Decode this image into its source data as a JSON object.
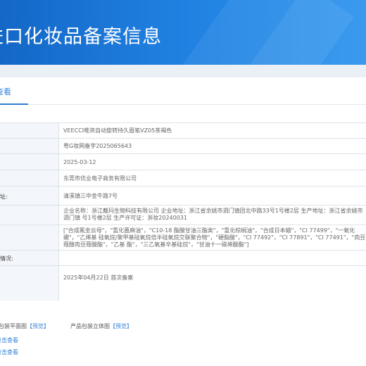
{
  "header": {
    "title": "进口化妆品备案信息"
  },
  "tab": {
    "label": "查看"
  },
  "rows": [
    {
      "label": "",
      "value": "VEECCI唯资自动旋转持久眉笔VZ05茶褐色"
    },
    {
      "label": "",
      "value": "粤G妆网备字2025065643"
    },
    {
      "label": "",
      "value": "2025-03-12"
    },
    {
      "label": "",
      "value": "东莞市优业电子商务有限公司"
    },
    {
      "label": "址:",
      "value": "清溪镇三中金牛路7号"
    },
    {
      "label": "",
      "value": "企业名称：浙江戴玛生物科技有限公司 企业地址：浙江省余姚市泗门镇团北中路33号1号楼2层 生产地址：浙江省余姚市泗门镇 号1号楼2层 生产许可证：浙妆20240031"
    },
    {
      "label": "",
      "value": "[\"合成氟金云母\"，\"氢化蓖麻油\"，\"C10-18 酯酸甘油三酯类\"，\"氢化棕榈油\"，\"合成日本蜡\"，\"CI 77499\"，\"一氧化硼\"，\"乙烯基 硅氧烷/聚甲基硅氧烷倍半硅氧烷交联聚合物\"，\"硬脂酸\"，\"CI 77492\"，\"CI 77891\"，\"CI 77491\"，\"肉豆蔻醇肉豆蔻酸酯\"，\"乙基 酯\"，\"三乙氧基辛基硅烷\"，\"甘油十一碳烯酸酯\"]"
    },
    {
      "label": "情况:",
      "value": ""
    },
    {
      "label": "",
      "value": "2025年04月22日 首次备案"
    }
  ],
  "packaging": {
    "flat_label": "包装平面图",
    "flat_link": "【预览】",
    "solid_label": "产品包装立体图",
    "solid_link": "【预览】"
  },
  "links": {
    "view1": "点击查看",
    "view2": "点击查看"
  }
}
